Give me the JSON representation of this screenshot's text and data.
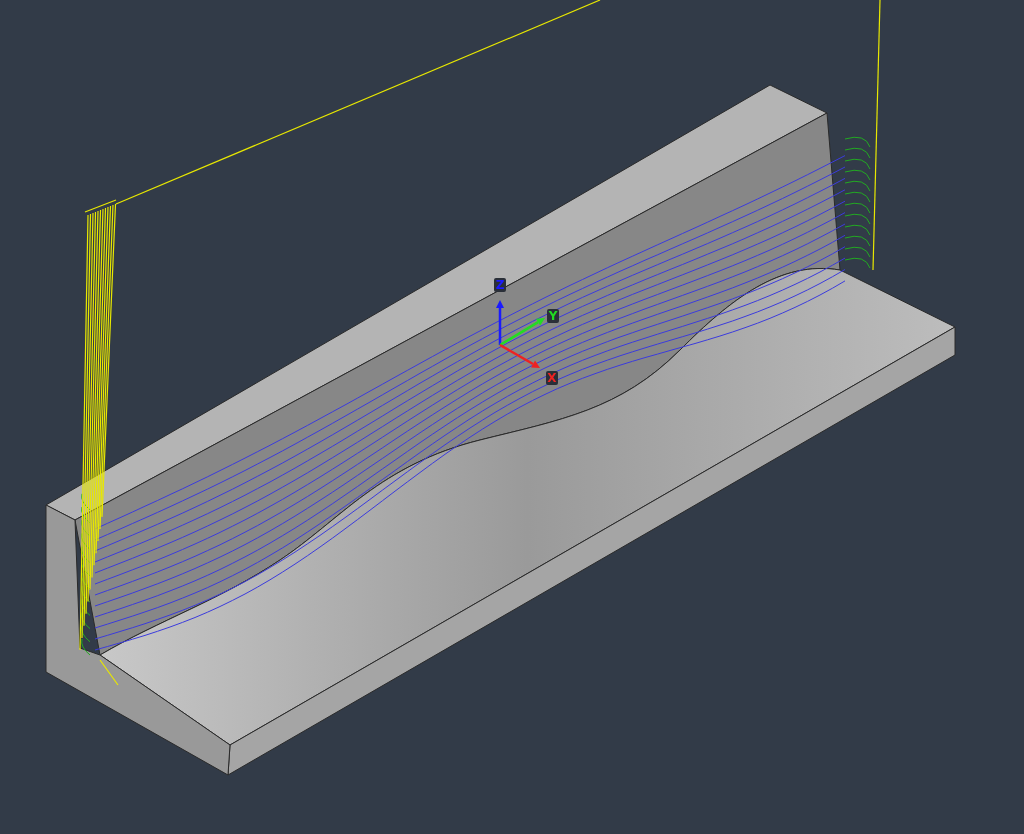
{
  "viewport": {
    "axes": [
      {
        "kind": "z",
        "label": "Z",
        "color": "#1a1aff"
      },
      {
        "kind": "y",
        "label": "Y",
        "color": "#22dd22"
      },
      {
        "kind": "x",
        "label": "X",
        "color": "#ee2222"
      }
    ]
  }
}
